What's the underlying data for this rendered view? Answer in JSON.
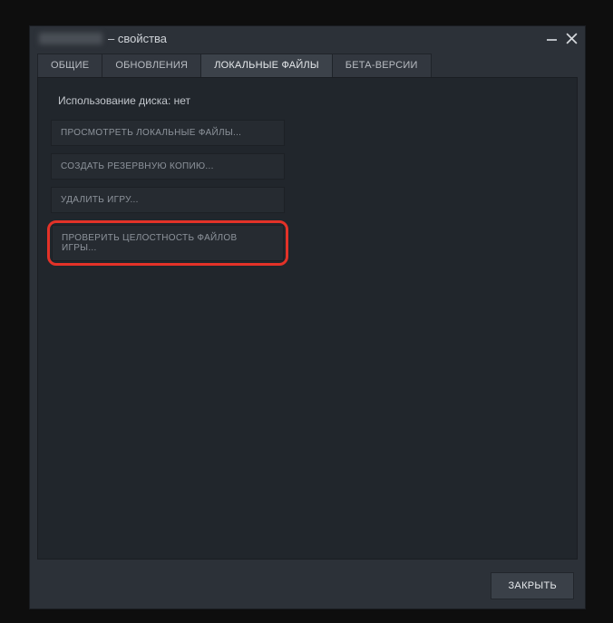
{
  "title_suffix": " – свойства",
  "tabs": {
    "general": "ОБЩИЕ",
    "updates": "ОБНОВЛЕНИЯ",
    "local": "ЛОКАЛЬНЫЕ ФАЙЛЫ",
    "betas": "БЕТА-ВЕРСИИ",
    "active": "local"
  },
  "panel": {
    "disk_usage": "Использование диска: нет",
    "browse": "ПРОСМОТРЕТЬ ЛОКАЛЬНЫЕ ФАЙЛЫ...",
    "backup": "СОЗДАТЬ РЕЗЕРВНУЮ КОПИЮ...",
    "delete": "УДАЛИТЬ ИГРУ...",
    "verify": "ПРОВЕРИТЬ ЦЕЛОСТНОСТЬ ФАЙЛОВ ИГРЫ..."
  },
  "footer": {
    "close": "ЗАКРЫТЬ"
  }
}
